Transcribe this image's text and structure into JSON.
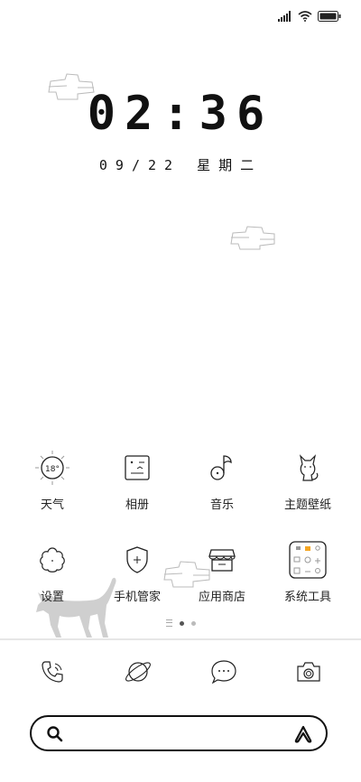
{
  "clock": {
    "time": "02:36",
    "date": "09/22 星期二"
  },
  "apps_row1": [
    {
      "label": "天气",
      "icon": "weather-icon",
      "temp": "18°"
    },
    {
      "label": "相册",
      "icon": "gallery-icon"
    },
    {
      "label": "音乐",
      "icon": "music-icon"
    },
    {
      "label": "主题壁纸",
      "icon": "theme-cat-icon"
    }
  ],
  "apps_row2": [
    {
      "label": "设置",
      "icon": "settings-flower-icon"
    },
    {
      "label": "手机管家",
      "icon": "security-shield-icon"
    },
    {
      "label": "应用商店",
      "icon": "app-store-icon"
    },
    {
      "label": "系统工具",
      "icon": "system-tools-folder-icon"
    }
  ],
  "page_indicator": {
    "pages": 2,
    "current": 1
  },
  "dock": [
    "phone-icon",
    "browser-icon",
    "messages-icon",
    "camera-icon"
  ],
  "search": {
    "placeholder": ""
  },
  "colors": {
    "line": "#222222",
    "cat": "#cfcfcf"
  }
}
